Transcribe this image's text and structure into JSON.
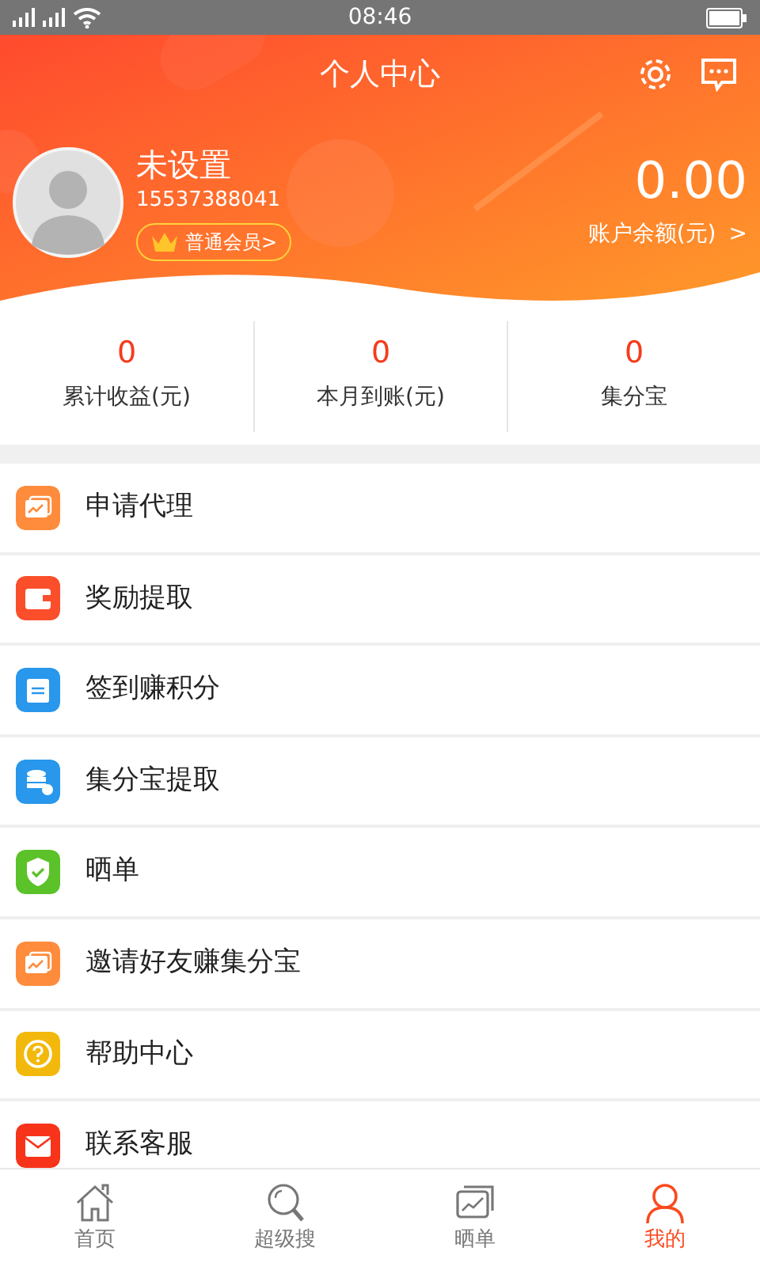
{
  "status_bar": {
    "time": "08:46"
  },
  "header": {
    "title": "个人中心"
  },
  "profile": {
    "name": "未设置",
    "phone": "15537388041",
    "membership": "普通会员>",
    "balance": "0.00",
    "balance_label": "账户余额(元)",
    "balance_arrow": ">"
  },
  "stats": [
    {
      "value": "0",
      "label": "累计收益(元)"
    },
    {
      "value": "0",
      "label": "本月到账(元)"
    },
    {
      "value": "0",
      "label": "集分宝"
    }
  ],
  "menu": [
    {
      "label": "申请代理",
      "kind": "chart",
      "color": "#ff8c3c"
    },
    {
      "label": "奖励提取",
      "kind": "wallet",
      "color": "#fb4f2c"
    },
    {
      "label": "签到赚积分",
      "kind": "calendar",
      "color": "#2897ec"
    },
    {
      "label": "集分宝提取",
      "kind": "database",
      "color": "#2897ec"
    },
    {
      "label": "晒单",
      "kind": "shield",
      "color": "#5cc22a"
    },
    {
      "label": "邀请好友赚集分宝",
      "kind": "chart",
      "color": "#ff8c3c"
    },
    {
      "label": "帮助中心",
      "kind": "help",
      "color": "#f2b90c"
    },
    {
      "label": "联系客服",
      "kind": "mail",
      "color": "#f7341a"
    }
  ],
  "tabs": [
    {
      "label": "首页",
      "kind": "home",
      "selected": false
    },
    {
      "label": "超级搜",
      "kind": "search",
      "selected": false
    },
    {
      "label": "晒单",
      "kind": "chart",
      "selected": false
    },
    {
      "label": "我的",
      "kind": "person",
      "selected": true
    }
  ]
}
